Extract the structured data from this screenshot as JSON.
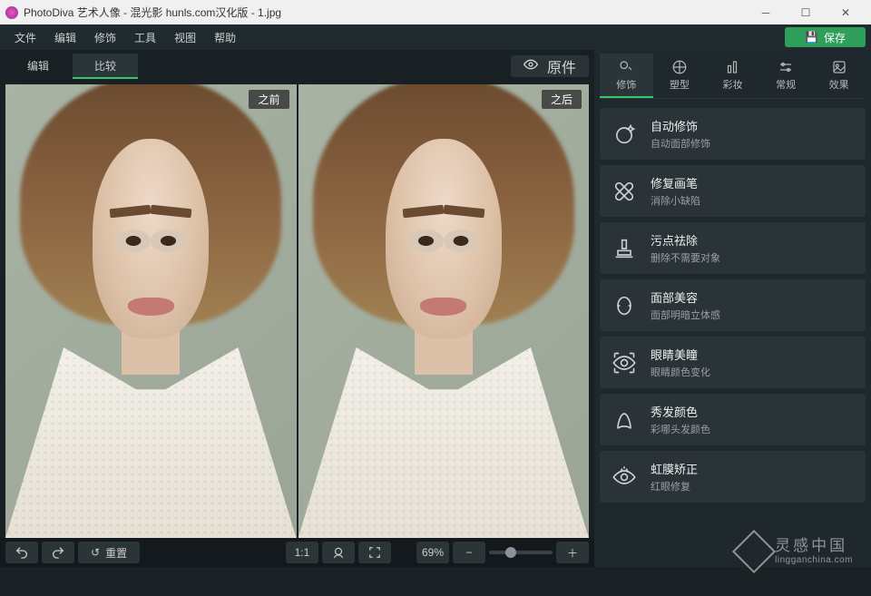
{
  "titlebar": {
    "title": "PhotoDiva 艺术人像 - 混光影 hunls.com汉化版 - 1.jpg"
  },
  "menu": {
    "items": [
      "文件",
      "编辑",
      "修饰",
      "工具",
      "视图",
      "帮助"
    ],
    "save": "保存"
  },
  "top_tabs": {
    "edit": "编辑",
    "compare": "比较",
    "original": "原件"
  },
  "canvas": {
    "before": "之前",
    "after": "之后"
  },
  "bottombar": {
    "reset": "重置",
    "ratio": "1:1",
    "zoom_pct": "69%"
  },
  "tool_tabs": [
    {
      "id": "retouch",
      "label": "修饰"
    },
    {
      "id": "sculpt",
      "label": "塑型"
    },
    {
      "id": "makeup",
      "label": "彩妆"
    },
    {
      "id": "general",
      "label": "常规"
    },
    {
      "id": "effects",
      "label": "效果"
    }
  ],
  "tools": [
    {
      "title": "自动修饰",
      "sub": "自动面部修饰",
      "icon": "sparkle-face"
    },
    {
      "title": "修复画笔",
      "sub": "消除小缺陷",
      "icon": "bandage"
    },
    {
      "title": "污点祛除",
      "sub": "删除不需要对象",
      "icon": "stamp"
    },
    {
      "title": "面部美容",
      "sub": "面部明暗立体感",
      "icon": "face-contour"
    },
    {
      "title": "眼睛美瞳",
      "sub": "眼睛颜色变化",
      "icon": "eye-target"
    },
    {
      "title": "秀发颜色",
      "sub": "彩哪头发颜色",
      "icon": "hair"
    },
    {
      "title": "虹膜矫正",
      "sub": "红眼修复",
      "icon": "eye-fix"
    }
  ],
  "watermark": {
    "cn": "灵感中国",
    "en": "lingganchina.com"
  }
}
